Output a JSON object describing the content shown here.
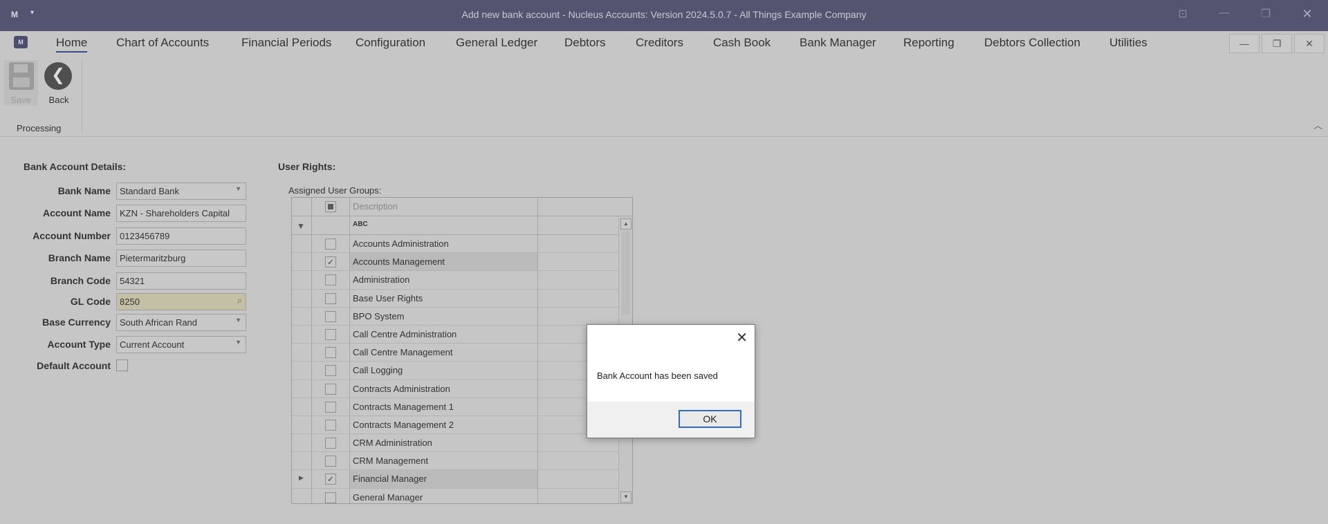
{
  "window": {
    "title": "Add new bank account - Nucleus Accounts: Version 2024.5.0.7 - All Things Example Company",
    "logo": "M",
    "caret": "▾"
  },
  "menu": {
    "app_icon": "M",
    "items": [
      {
        "label": "Home"
      },
      {
        "label": "Chart of Accounts"
      },
      {
        "label": "Financial Periods"
      },
      {
        "label": "Configuration"
      },
      {
        "label": "General Ledger"
      },
      {
        "label": "Debtors"
      },
      {
        "label": "Creditors"
      },
      {
        "label": "Cash Book"
      },
      {
        "label": "Bank Manager"
      },
      {
        "label": "Reporting"
      },
      {
        "label": "Debtors Collection"
      },
      {
        "label": "Utilities"
      }
    ],
    "active_index": 0
  },
  "ribbon": {
    "save_label": "Save",
    "back_label": "Back",
    "group_label": "Processing"
  },
  "bank_account": {
    "section_title": "Bank Account Details:",
    "fields": {
      "bank_name": {
        "label": "Bank Name",
        "value": "Standard Bank"
      },
      "account_name": {
        "label": "Account Name",
        "value": "KZN - Shareholders Capital"
      },
      "account_number": {
        "label": "Account Number",
        "value": "0123456789"
      },
      "branch_name": {
        "label": "Branch Name",
        "value": "Pietermaritzburg"
      },
      "branch_code": {
        "label": "Branch Code",
        "value": "54321"
      },
      "gl_code": {
        "label": "GL Code",
        "value": "8250"
      },
      "base_currency": {
        "label": "Base Currency",
        "value": "South African Rand"
      },
      "account_type": {
        "label": "Account Type",
        "value": "Current Account"
      },
      "default_account": {
        "label": "Default Account",
        "checked": false
      }
    }
  },
  "user_rights": {
    "section_title": "User Rights:",
    "assigned_label": "Assigned User Groups:",
    "column_header": "Description",
    "filter_icon_text": "ABC",
    "groups": [
      {
        "name": "Accounts Administration",
        "checked": false
      },
      {
        "name": "Accounts Management",
        "checked": true
      },
      {
        "name": "Administration",
        "checked": false
      },
      {
        "name": "Base User Rights",
        "checked": false
      },
      {
        "name": "BPO System",
        "checked": false
      },
      {
        "name": "Call Centre Administration",
        "checked": false
      },
      {
        "name": "Call Centre Management",
        "checked": false
      },
      {
        "name": "Call Logging",
        "checked": false
      },
      {
        "name": "Contracts Administration",
        "checked": false
      },
      {
        "name": "Contracts Management 1",
        "checked": false
      },
      {
        "name": "Contracts Management 2",
        "checked": false
      },
      {
        "name": "CRM Administration",
        "checked": false
      },
      {
        "name": "CRM Management",
        "checked": false
      },
      {
        "name": "Financial Manager",
        "checked": true,
        "current": true
      },
      {
        "name": "General Manager",
        "checked": false
      }
    ]
  },
  "dialog": {
    "message": "Bank Account has been saved",
    "ok_label": "OK"
  },
  "icons": {
    "check": "✓",
    "close": "✕",
    "minimize": "—",
    "restore": "❐",
    "back": "❮",
    "dropdown": "▼",
    "lookup": "⌕",
    "filter": "▼",
    "row_indicator": "▶",
    "scroll_up": "▲",
    "scroll_down": "▼",
    "collapse": "︿",
    "pin": "⊡"
  }
}
